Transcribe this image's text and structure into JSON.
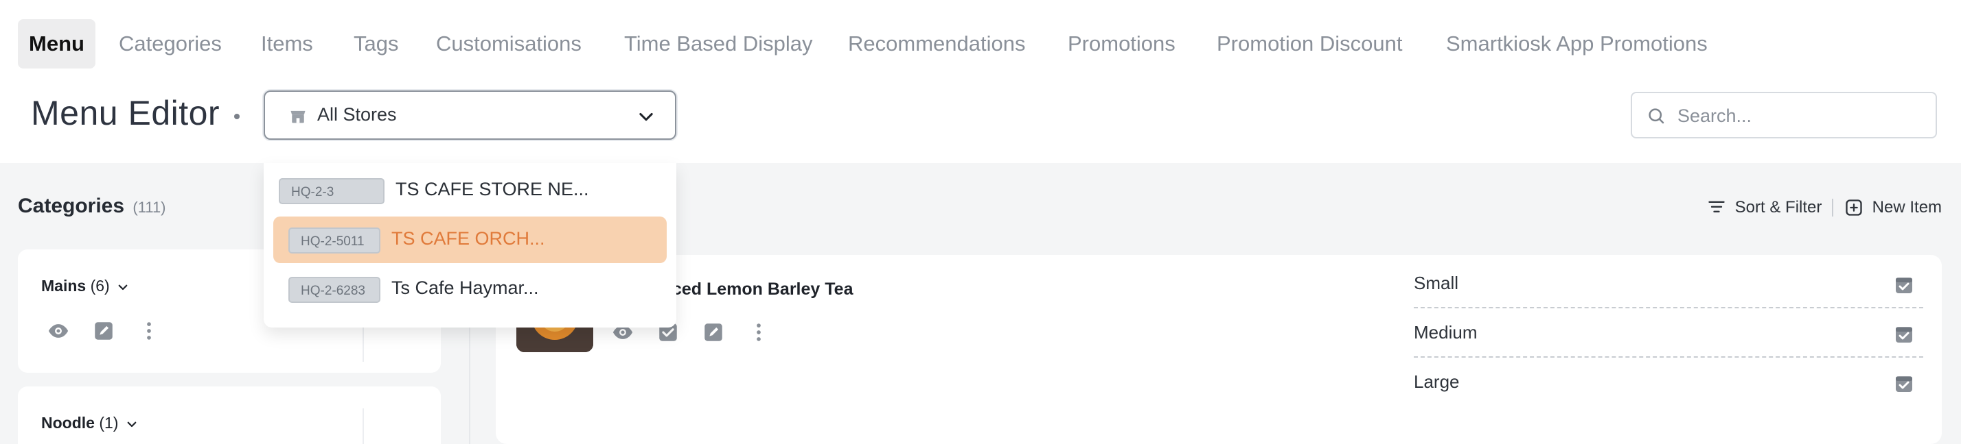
{
  "nav": {
    "tabs": [
      {
        "label": "Menu",
        "active": true
      },
      {
        "label": "Categories"
      },
      {
        "label": "Items"
      },
      {
        "label": "Tags"
      },
      {
        "label": "Customisations"
      },
      {
        "label": "Time Based Display"
      },
      {
        "label": "Recommendations"
      },
      {
        "label": "Promotions"
      },
      {
        "label": "Promotion Discount"
      },
      {
        "label": "Smartkiosk App Promotions"
      }
    ]
  },
  "header": {
    "title": "Menu Editor",
    "store_select": {
      "value": "All Stores",
      "icon": "store-icon"
    },
    "search": {
      "placeholder": "Search..."
    }
  },
  "dropdown": {
    "options": [
      {
        "code": "HQ-2-3",
        "name": "TS CAFE STORE NE...",
        "selected": false
      },
      {
        "code": "HQ-2-5011",
        "name": "TS CAFE ORCH...",
        "selected": true
      },
      {
        "code": "HQ-2-6283",
        "name": "Ts Cafe Haymar...",
        "selected": false
      }
    ]
  },
  "categories": {
    "title": "Categories",
    "count": "(111)",
    "cards": [
      {
        "name": "Mains",
        "count": "(6)"
      },
      {
        "name": "Noodle",
        "count": "(1)"
      }
    ]
  },
  "toolbar": {
    "sort_filter_label": "Sort & Filter",
    "new_item_label": "New Item"
  },
  "item": {
    "name": "Iced Lemon Barley Tea",
    "sizes": [
      {
        "label": "Small"
      },
      {
        "label": "Medium"
      },
      {
        "label": "Large"
      }
    ]
  },
  "colors": {
    "accent": "#e07a3a",
    "selected_bg": "#f8d2b0",
    "content_bg": "#f4f5f6"
  }
}
